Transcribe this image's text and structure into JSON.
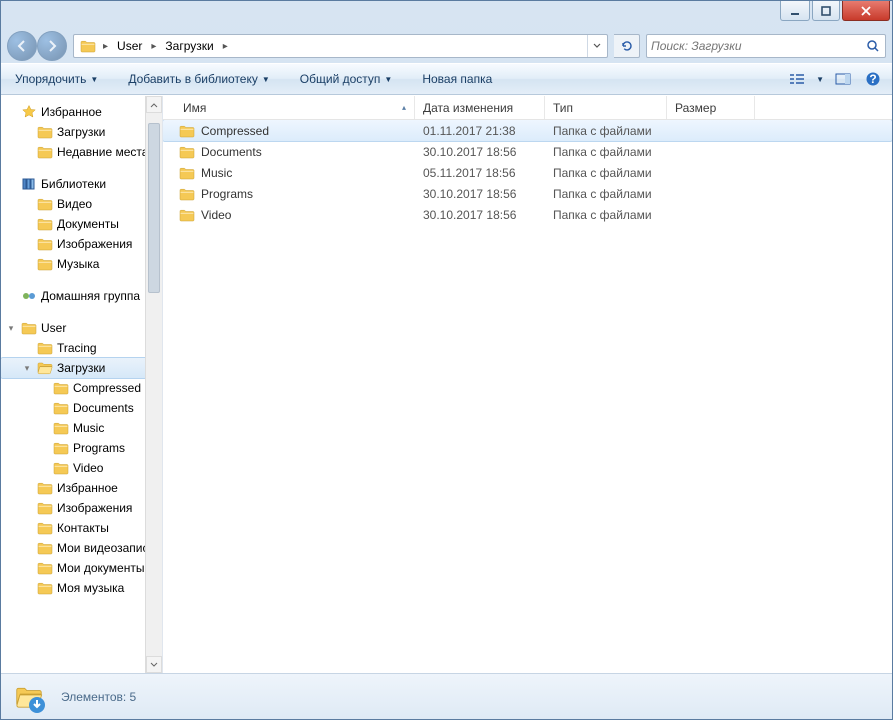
{
  "window": {
    "titlebar": {
      "min": "min",
      "max": "max",
      "close": "close"
    }
  },
  "nav": {
    "breadcrumb": [
      "User",
      "Загрузки"
    ],
    "search_placeholder": "Поиск: Загрузки"
  },
  "toolbar": {
    "organize": "Упорядочить",
    "include": "Добавить в библиотеку",
    "share": "Общий доступ",
    "newfolder": "Новая папка"
  },
  "columns": {
    "name": "Имя",
    "date": "Дата изменения",
    "type": "Тип",
    "size": "Размер"
  },
  "tree": {
    "favorites": {
      "label": "Избранное",
      "items": [
        "Загрузки",
        "Недавние места"
      ]
    },
    "libraries": {
      "label": "Библиотеки",
      "items": [
        "Видео",
        "Документы",
        "Изображения",
        "Музыка"
      ]
    },
    "homegroup": {
      "label": "Домашняя группа"
    },
    "user": {
      "label": "User",
      "items": [
        "Tracing",
        "Загрузки"
      ],
      "downloads_children": [
        "Compressed",
        "Documents",
        "Music",
        "Programs",
        "Video"
      ],
      "rest": [
        "Избранное",
        "Изображения",
        "Контакты",
        "Мои видеозаписи",
        "Мои документы",
        "Моя музыка"
      ]
    }
  },
  "files": [
    {
      "name": "Compressed",
      "date": "01.11.2017 21:38",
      "type": "Папка с файлами",
      "size": ""
    },
    {
      "name": "Documents",
      "date": "30.10.2017 18:56",
      "type": "Папка с файлами",
      "size": ""
    },
    {
      "name": "Music",
      "date": "05.11.2017 18:56",
      "type": "Папка с файлами",
      "size": ""
    },
    {
      "name": "Programs",
      "date": "30.10.2017 18:56",
      "type": "Папка с файлами",
      "size": ""
    },
    {
      "name": "Video",
      "date": "30.10.2017 18:56",
      "type": "Папка с файлами",
      "size": ""
    }
  ],
  "status": {
    "text": "Элементов: 5"
  }
}
